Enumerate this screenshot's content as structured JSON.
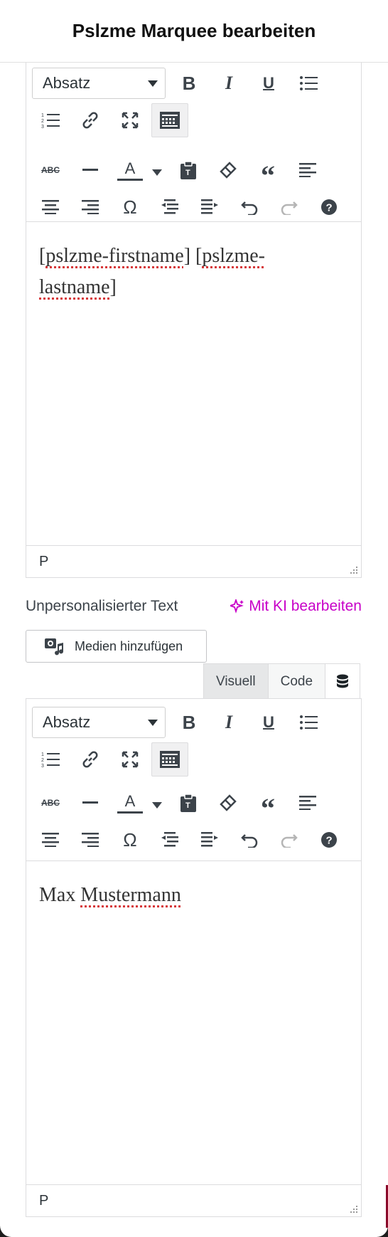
{
  "header": {
    "title": "Pslzme Marquee bearbeiten"
  },
  "editor1": {
    "format_select": "Absatz",
    "content_line1_parts": [
      "[",
      "pslzme-firstname",
      "] [",
      "pslzme-"
    ],
    "content_line2_parts": [
      "lastname",
      "]"
    ],
    "status_path": "P"
  },
  "section": {
    "label": "Unpersonalisierter Text",
    "ai_link": "Mit KI bearbeiten",
    "media_button": "Medien hinzufügen"
  },
  "tabs": {
    "visual": "Visuell",
    "code": "Code",
    "active": "Visuell"
  },
  "editor2": {
    "format_select": "Absatz",
    "content_parts": [
      "Max ",
      "Mustermann"
    ],
    "status_path": "P"
  },
  "toolbar_icons": {
    "row1": [
      "bold-icon",
      "italic-icon",
      "underline-icon",
      "bullet-list-icon"
    ],
    "row2": [
      "numbered-list-icon",
      "link-icon",
      "fullscreen-icon",
      "toolbar-toggle-icon"
    ],
    "row3": [
      "strikethrough-icon",
      "horizontal-line-icon",
      "text-color-icon",
      "text-color-dropdown-icon",
      "paste-as-text-icon",
      "clear-formatting-icon",
      "blockquote-icon",
      "align-left-icon"
    ],
    "row4": [
      "align-center-icon",
      "align-right-icon",
      "special-character-icon",
      "outdent-icon",
      "indent-icon",
      "undo-icon",
      "redo-icon",
      "help-icon"
    ]
  },
  "colors": {
    "accent": "#c800c8",
    "text": "#2c3338",
    "border": "#dcdcde",
    "spellcheck": "#d63638"
  }
}
